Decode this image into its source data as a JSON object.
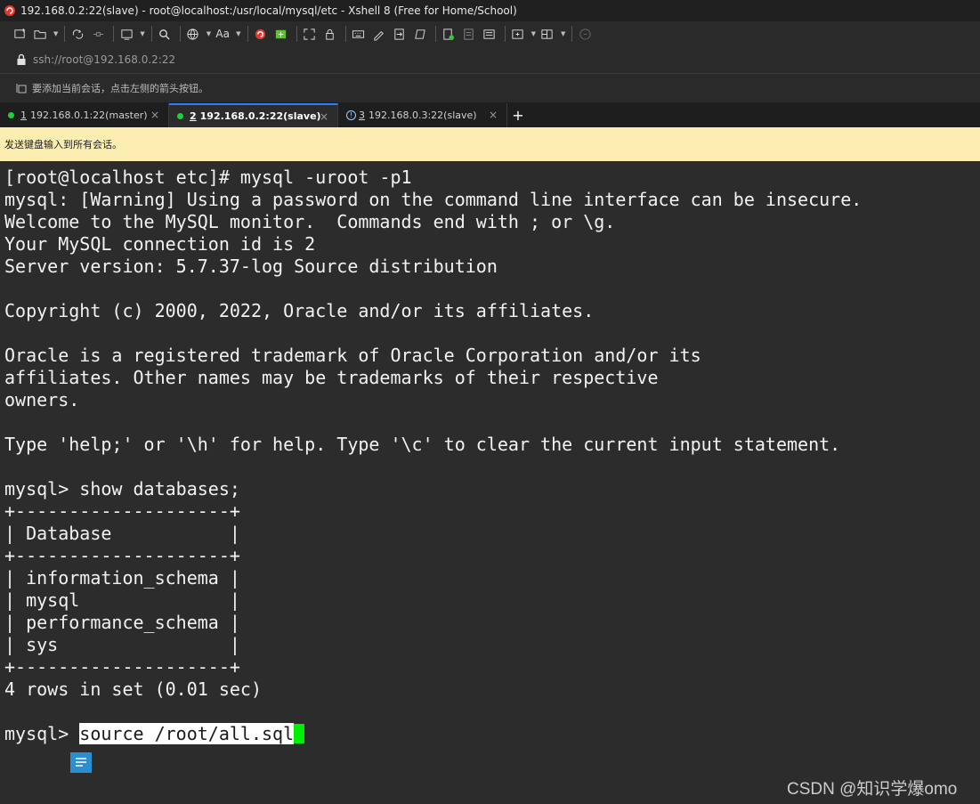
{
  "window": {
    "title": "192.168.0.2:22(slave) - root@localhost:/usr/local/mysql/etc - Xshell 8 (Free for Home/School)"
  },
  "toolbar": {
    "font_label": "Aa",
    "icons": [
      "new-session-icon",
      "open-folder-icon",
      "reconnect-icon",
      "disconnect-icon",
      "new-tab-icon",
      "find-icon",
      "globe-icon",
      "font-icon",
      "xshell-logo-icon",
      "xftp-icon",
      "fullscreen-icon",
      "lock-icon",
      "keyboard-icon",
      "script-icon",
      "transfer-icon",
      "compose-icon",
      "log-icon",
      "capture-icon",
      "layout-icon",
      "split-icon",
      "help-icon"
    ]
  },
  "address": {
    "text": "ssh://root@192.168.0.2:22"
  },
  "hint": {
    "text": "要添加当前会话，点击左侧的箭头按钮。"
  },
  "tabs": [
    {
      "index": "1",
      "label": "192.168.0.1:22(master)",
      "status": "connected"
    },
    {
      "index": "2",
      "label": "192.168.0.2:22(slave)",
      "status": "connected"
    },
    {
      "index": "3",
      "label": "192.168.0.3:22(slave)",
      "status": "warning"
    }
  ],
  "tab_add": "+",
  "tab_close": "×",
  "notice": {
    "text": "发送键盘输入到所有会话。"
  },
  "terminal": {
    "lines": [
      "[root@localhost etc]# mysql -uroot -p1",
      "mysql: [Warning] Using a password on the command line interface can be insecure.",
      "Welcome to the MySQL monitor.  Commands end with ; or \\g.",
      "Your MySQL connection id is 2",
      "Server version: 5.7.37-log Source distribution",
      "",
      "Copyright (c) 2000, 2022, Oracle and/or its affiliates.",
      "",
      "Oracle is a registered trademark of Oracle Corporation and/or its",
      "affiliates. Other names may be trademarks of their respective",
      "owners.",
      "",
      "Type 'help;' or '\\h' for help. Type '\\c' to clear the current input statement.",
      "",
      "mysql> show databases;",
      "+--------------------+",
      "| Database           |",
      "+--------------------+",
      "| information_schema |",
      "| mysql              |",
      "| performance_schema |",
      "| sys                |",
      "+--------------------+",
      "4 rows in set (0.01 sec)",
      ""
    ],
    "prompt": "mysql> ",
    "current_command": "source /root/all.sql"
  },
  "watermark": "CSDN @知识学爆omo",
  "colors": {
    "cursor": "#00ee00",
    "notice_bg": "#fbeeb0",
    "terminal_bg": "#2c2c2c",
    "active_tab_accent": "#2e7dff",
    "status_connected": "#1fcf3c"
  }
}
